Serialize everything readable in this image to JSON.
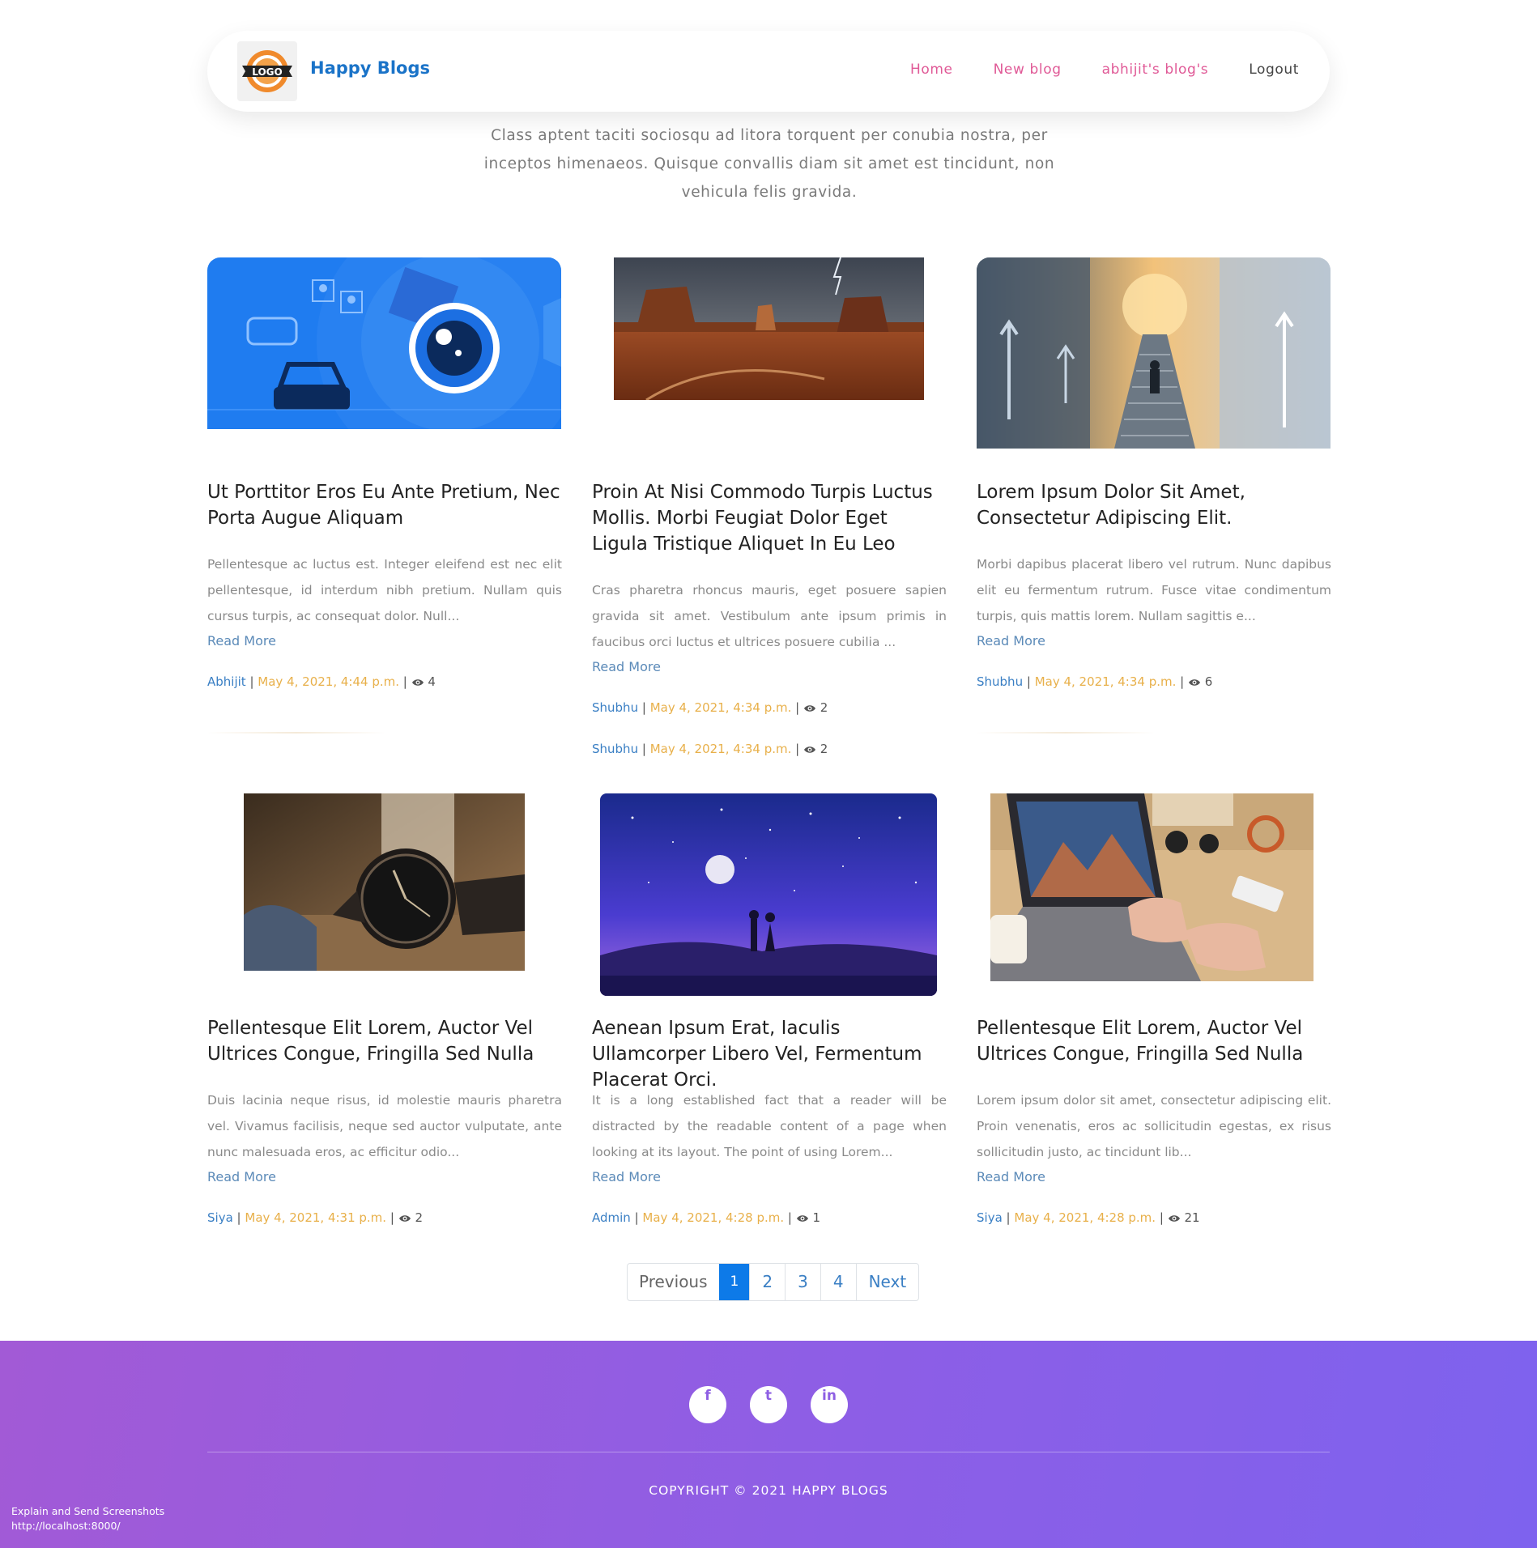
{
  "nav": {
    "brand": "Happy Blogs",
    "logo_text": "LOGO",
    "links": [
      "Home",
      "New blog",
      "abhijit's blog's",
      "Logout"
    ]
  },
  "intro": "Class aptent taciti sociosqu ad litora torquent per conubia nostra, per inceptos himenaeos. Quisque convallis diam sit amet est tincidunt, non vehicula felis gravida.",
  "posts": [
    {
      "title": "Ut Porttitor Eros Eu Ante Pretium, Nec Porta Augue Aliquam",
      "excerpt": "Pellentesque ac luctus est. Integer eleifend est nec elit pellentesque, id interdum nibh pretium. Nullam quis cursus turpis, ac consequat dolor. Null...",
      "read_more": "Read More",
      "author": "Abhijit",
      "date": "May 4, 2021, 4:44 p.m.",
      "views": "4",
      "image": "blue-car-camera-illustration"
    },
    {
      "title": "Proin At Nisi Commodo Turpis Luctus Mollis. Morbi Feugiat Dolor Eget Ligula Tristique Aliquet In Eu Leo",
      "excerpt": "Cras pharetra rhoncus mauris, eget posuere sapien gravida sit amet. Vestibulum ante ipsum primis in faucibus orci luctus et ultrices posuere cubilia ...",
      "read_more": "Read More",
      "author": "Shubhu",
      "date": "May 4, 2021, 4:34 p.m.",
      "views": "2",
      "image": "desert-mesa-landscape"
    },
    {
      "title": "Lorem Ipsum Dolor Sit Amet, Consectetur Adipiscing Elit.",
      "excerpt": "Morbi dapibus placerat libero vel rutrum. Nunc dapibus elit eu fermentum rutrum. Fusce vitae condimentum turpis, quis mattis lorem. Nullam sagittis e...",
      "read_more": "Read More",
      "author": "Shubhu",
      "date": "May 4, 2021, 4:34 p.m.",
      "views": "6",
      "image": "man-climbing-stairs-city"
    },
    {
      "title": "Pellentesque Elit Lorem, Auctor Vel Ultrices Congue, Fringilla Sed Nulla",
      "excerpt": "Duis lacinia neque risus, id molestie mauris pharetra vel. Vivamus facilisis, neque sed auctor vulputate, ante nunc malesuada eros, ac efficitur odio...",
      "read_more": "Read More",
      "author": "Siya",
      "date": "May 4, 2021, 4:31 p.m.",
      "views": "2",
      "image": "wristwatch-on-table"
    },
    {
      "title": "Aenean Ipsum Erat, Iaculis Ullamcorper Libero Vel, Fermentum Placerat Orci.",
      "excerpt": "It is a long established fact that a reader will be distracted by the readable content of a page when looking at its layout. The point of using Lorem...",
      "read_more": "Read More",
      "author": "Admin",
      "date": "May 4, 2021, 4:28 p.m.",
      "views": "1",
      "image": "couple-under-starry-night"
    },
    {
      "title": "Pellentesque Elit Lorem, Auctor Vel Ultrices Congue, Fringilla Sed Nulla",
      "excerpt": "Lorem ipsum dolor sit amet, consectetur adipiscing elit. Proin venenatis, eros ac sollicitudin egestas, ex risus sollicitudin justo, ac tincidunt lib...",
      "read_more": "Read More",
      "author": "Siya",
      "date": "May 4, 2021, 4:28 p.m.",
      "views": "21",
      "image": "laptop-on-desk"
    }
  ],
  "extra_meta": {
    "author": "Shubhu",
    "date": "May 4, 2021, 4:34 p.m.",
    "views": "2"
  },
  "pagination": {
    "previous": "Previous",
    "pages": [
      "1",
      "2",
      "3",
      "4"
    ],
    "active": "1",
    "next": "Next"
  },
  "footer": {
    "social": [
      {
        "name": "facebook-icon",
        "glyph": "f"
      },
      {
        "name": "twitter-icon",
        "glyph": "t"
      },
      {
        "name": "linkedin-icon",
        "glyph": "in"
      }
    ],
    "copyright": "COPYRIGHT © 2021 HAPPY BLOGS"
  },
  "overlay": {
    "line1": "Explain and Send Screenshots",
    "line2": "http://localhost:8000/"
  },
  "colors": {
    "brand": "#1a73c8",
    "nav_link": "#e05a97",
    "author": "#3a7fc4",
    "date": "#e8b04a",
    "footer_start": "#a25ad6",
    "footer_end": "#7e62ee",
    "pagination_active": "#0d7ae8"
  }
}
